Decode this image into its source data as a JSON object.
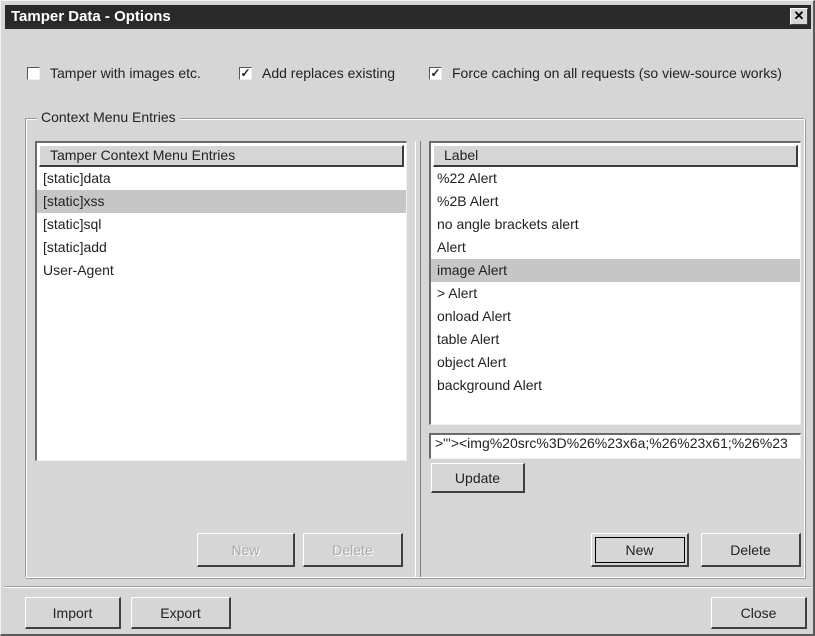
{
  "window": {
    "title": "Tamper Data - Options",
    "close_glyph": "✕"
  },
  "options": [
    {
      "label": "Tamper with images etc.",
      "checked": false
    },
    {
      "label": "Add replaces existing",
      "checked": true
    },
    {
      "label": "Force caching on all requests (so view-source works)",
      "checked": true
    }
  ],
  "context_menu": {
    "group_label": "Context Menu Entries",
    "left_list": {
      "header": "Tamper Context Menu Entries",
      "items": [
        "[static]data",
        "[static]xss",
        "[static]sql",
        "[static]add",
        "User-Agent"
      ],
      "selected_index": 1
    },
    "right_list": {
      "header": "Label",
      "items": [
        "%22 Alert",
        "%2B Alert",
        "no angle brackets alert",
        "Alert",
        "image Alert",
        "> Alert",
        "onload Alert",
        "table Alert",
        "object Alert",
        "background Alert"
      ],
      "selected_index": 4
    },
    "value_field": ">\"'><img%20src%3D%26%23x6a;%26%23x61;%26%23",
    "buttons": {
      "update": "Update",
      "left_new": "New",
      "left_delete": "Delete",
      "right_new": "New",
      "right_delete": "Delete"
    }
  },
  "footer": {
    "import": "Import",
    "export": "Export",
    "close": "Close"
  },
  "colors": {
    "face": "#d6d6d6",
    "titlebar": "#2a2a2a",
    "selection": "#c6c6c6"
  }
}
